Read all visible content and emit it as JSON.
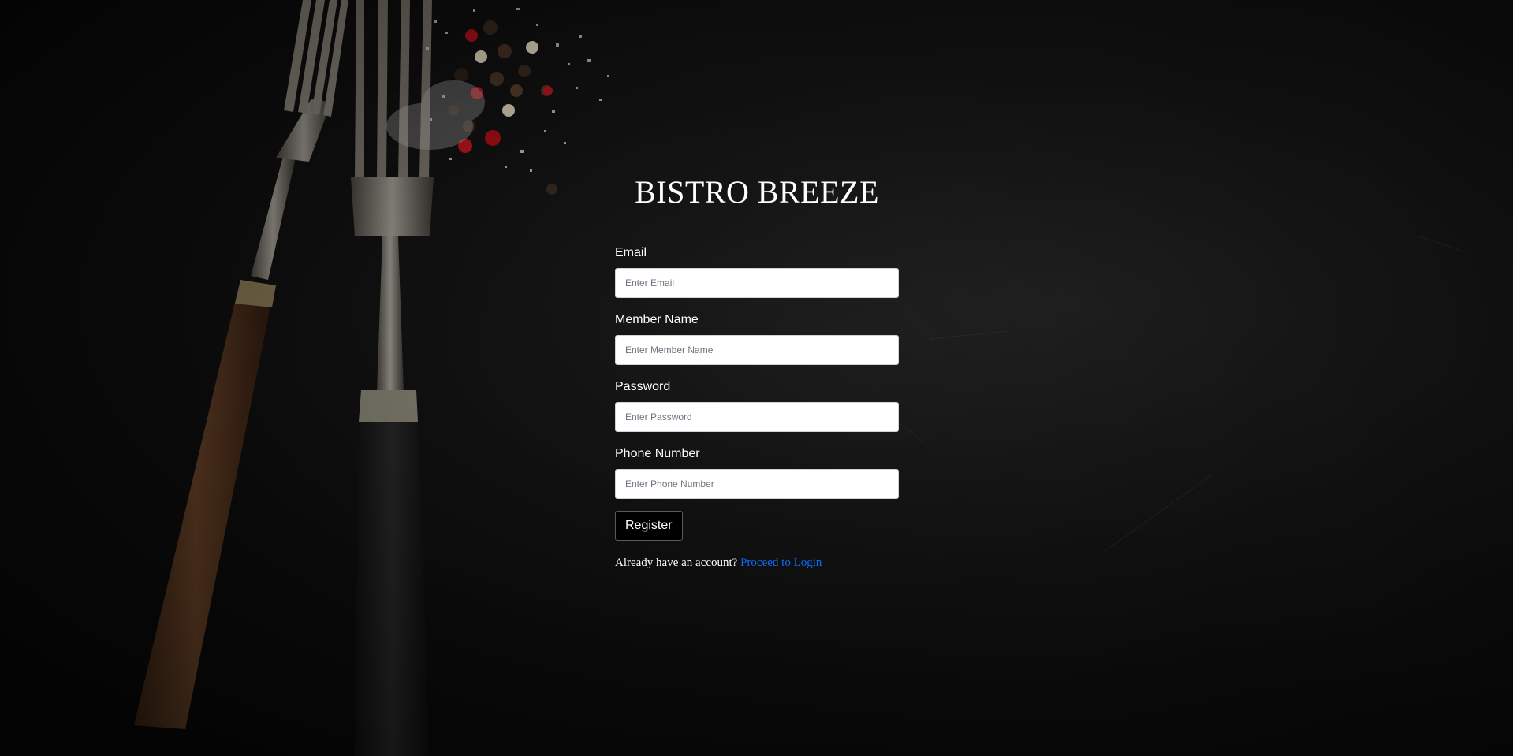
{
  "brand": {
    "title": "BISTRO BREEZE"
  },
  "form": {
    "fields": [
      {
        "label": "Email",
        "placeholder": "Enter Email",
        "value": ""
      },
      {
        "label": "Member Name",
        "placeholder": "Enter Member Name",
        "value": ""
      },
      {
        "label": "Password",
        "placeholder": "Enter Password",
        "value": ""
      },
      {
        "label": "Phone Number",
        "placeholder": "Enter Phone Number",
        "value": ""
      }
    ],
    "submit_label": "Register",
    "login_prompt": "Already have an account?",
    "login_link": "Proceed to Login"
  },
  "background": {
    "image": "two-forks-with-peppercorns-and-salt-on-dark-stone",
    "link_color": "#0d6efd"
  }
}
